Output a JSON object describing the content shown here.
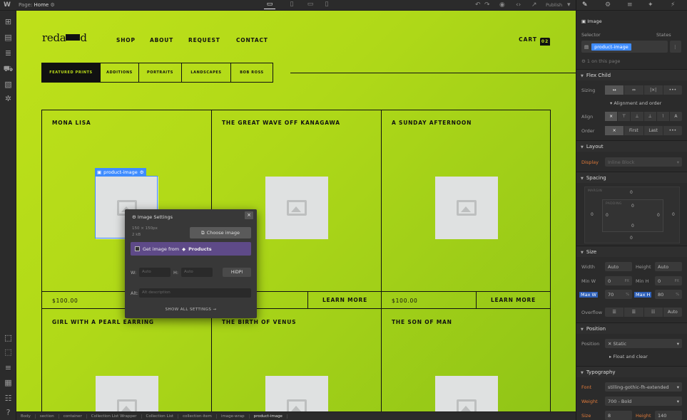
{
  "topbar": {
    "logo": "W",
    "page_prefix": "Page:",
    "page_name": "Home",
    "publish_label": "Publish"
  },
  "site": {
    "brand_prefix": "reda",
    "brand_suffix": "d",
    "nav": [
      "SHOP",
      "ABOUT",
      "REQUEST",
      "CONTACT"
    ],
    "cart_label": "CART",
    "cart_count": "02",
    "tabs": [
      "FEATURED PRINTS",
      "ADDITIONS",
      "PORTRAITS",
      "LANDSCAPES",
      "BOB ROSS"
    ],
    "products_row1": [
      "MONA LISA",
      "THE GREAT WAVE OFF KANAGAWA",
      "A SUNDAY AFTERNOON"
    ],
    "products_row2": [
      "GIRL WITH A PEARL EARRING",
      "THE BIRTH OF VENUS",
      "THE SON OF MAN"
    ],
    "price": "$100.00",
    "learn_more": "LEARN MORE",
    "selected_tag": "product-image"
  },
  "popover": {
    "title": "Image Settings",
    "dimensions": "150 × 150px",
    "filesize": "2 kB",
    "choose_label": "Choose image",
    "get_from": "Get image from",
    "source": "Products",
    "w_label": "W:",
    "h_label": "H:",
    "w_value": "Auto",
    "h_value": "Auto",
    "hidpi": "HiDPI",
    "alt_label": "Alt:",
    "alt_placeholder": "Alt description",
    "show_all": "SHOW ALL SETTINGS →"
  },
  "panel": {
    "element_type": "Image",
    "selector_label": "Selector",
    "states_label": "States",
    "selector_value": "product-image",
    "on_page": "1 on this page",
    "flex_child": "Flex Child",
    "sizing_label": "Sizing",
    "align_order": "Alignment and order",
    "align_label": "Align",
    "order_label": "Order",
    "order_first": "First",
    "order_last": "Last",
    "layout": "Layout",
    "display_label": "Display",
    "display_value": "Inline Block",
    "spacing": "Spacing",
    "margin_caption": "MARGIN",
    "padding_caption": "PADDING",
    "zero": "0",
    "size": "Size",
    "width_label": "Width",
    "height_label": "Height",
    "auto": "Auto",
    "minw_label": "Min W",
    "minh_label": "Min H",
    "maxw_label": "Max W",
    "maxh_label": "Max H",
    "maxw_value": "70",
    "maxh_value": "80",
    "px_unit": "PX",
    "pct_unit": "%",
    "overflow_label": "Overflow",
    "position": "Position",
    "position_label": "Position",
    "position_value": "Static",
    "float_clear": "Float and clear",
    "typography": "Typography",
    "font_label": "Font",
    "font_value": "stilling-gothic-fh-extended",
    "weight_label": "Weight",
    "weight_value": "700 - Bold",
    "size_label": "Size",
    "size_value": "8",
    "lineheight_label": "Height",
    "lineheight_value": "140"
  },
  "breadcrumbs": [
    "Body",
    "section",
    "container",
    "Collection List Wrapper",
    "Collection List",
    "collection-item",
    "image-wrap",
    "product-image"
  ]
}
